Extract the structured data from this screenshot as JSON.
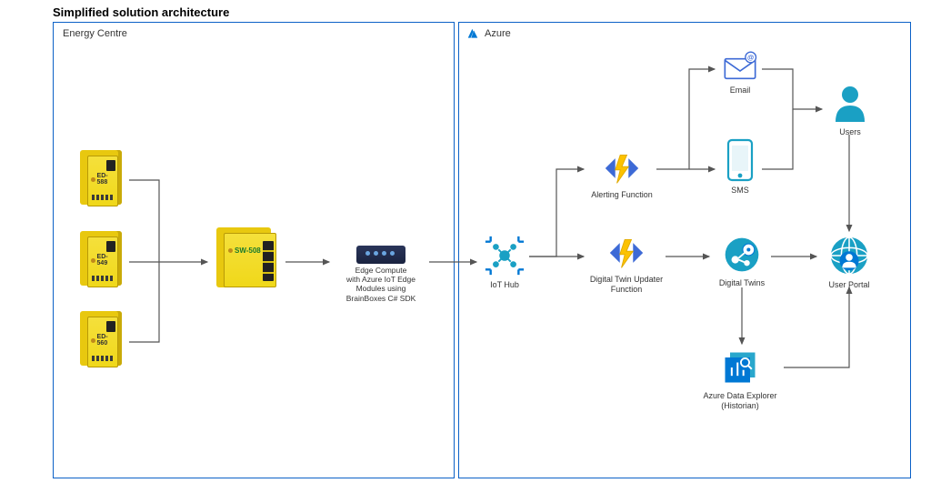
{
  "title": "Simplified solution architecture",
  "containers": {
    "energy": {
      "label": "Energy Centre"
    },
    "azure": {
      "label": "Azure"
    }
  },
  "devices": {
    "ed588": "ED-588",
    "ed549": "ED-549",
    "ed560": "ED-560",
    "sw508": "SW-508"
  },
  "nodes": {
    "edgeCompute": "Edge Compute\nwith Azure IoT Edge\nModules using\nBrainBoxes C# SDK",
    "iotHub": "IoT Hub",
    "alerting": "Alerting Function",
    "digitalTwinUpdater": "Digital Twin Updater\nFunction",
    "email": "Email",
    "sms": "SMS",
    "digitalTwins": "Digital Twins",
    "adx": "Azure Data Explorer\n(Historian)",
    "users": "Users",
    "userPortal": "User Portal"
  },
  "colors": {
    "azureBlue": "#0078d4",
    "funcBolt": "#fcc200",
    "funcAccent": "#3d6ad6",
    "border": "#0b61c7",
    "deviceYellow": "#f0d81a",
    "cyan": "#1aa0c4"
  }
}
